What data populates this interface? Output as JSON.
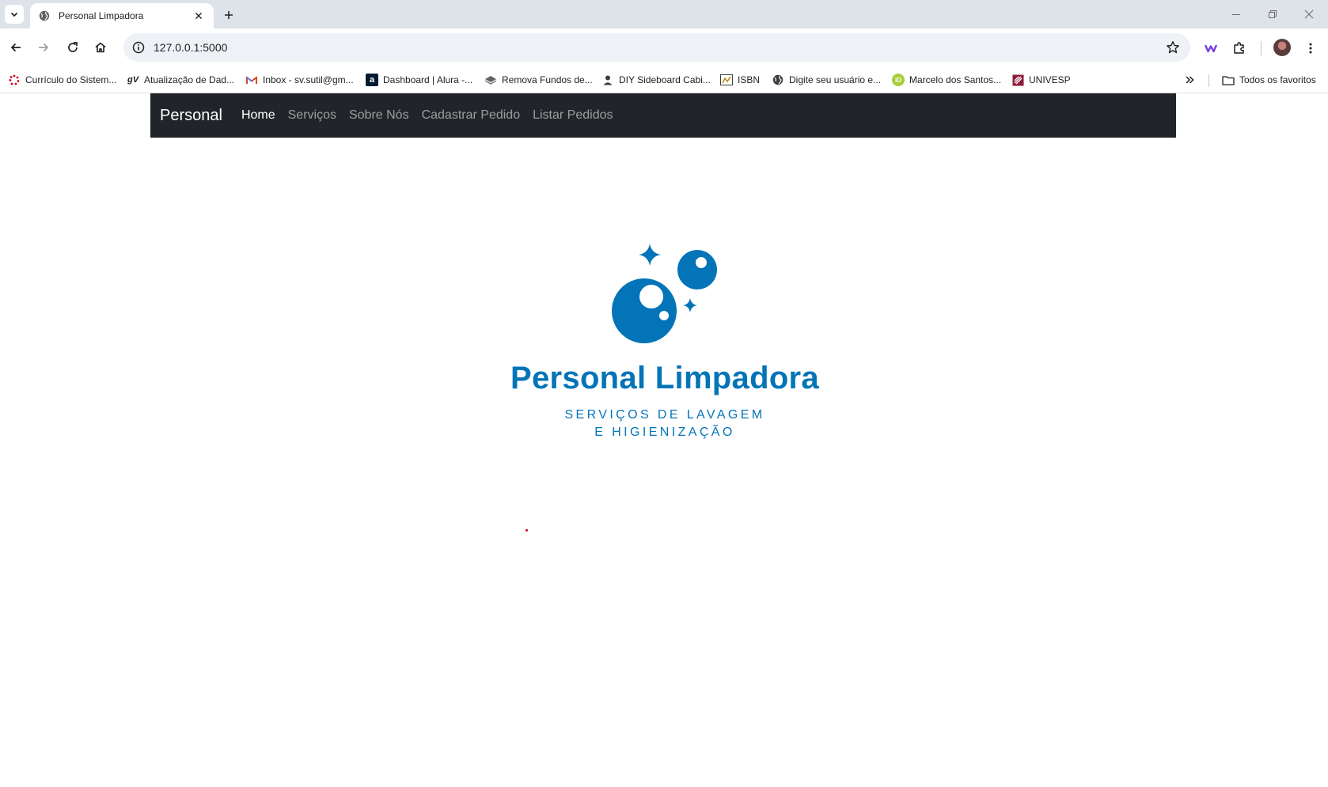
{
  "browser": {
    "tab_title": "Personal Limpadora",
    "url": "127.0.0.1:5000",
    "bookmarks": [
      {
        "label": "Currículo do Sistem...",
        "icon": "lattes-icon"
      },
      {
        "label": "Atualização de Dad...",
        "icon": "gv-icon"
      },
      {
        "label": "Inbox - sv.sutil@gm...",
        "icon": "gmail-icon"
      },
      {
        "label": "Dashboard | Alura -...",
        "icon": "alura-icon"
      },
      {
        "label": "Remova Fundos de...",
        "icon": "layers-icon"
      },
      {
        "label": "DIY Sideboard Cabi...",
        "icon": "person-icon"
      },
      {
        "label": "ISBN",
        "icon": "isbn-icon"
      },
      {
        "label": "Digite seu usuário e...",
        "icon": "globe-icon"
      },
      {
        "label": "Marcelo dos Santos...",
        "icon": "id-icon"
      },
      {
        "label": "UNIVESP",
        "icon": "univesp-icon"
      }
    ],
    "all_bookmarks_label": "Todos os favoritos"
  },
  "navbar": {
    "brand": "Personal",
    "links": [
      "Home",
      "Serviços",
      "Sobre Nós",
      "Cadastrar Pedido",
      "Listar Pedidos"
    ],
    "active": "Home"
  },
  "logo": {
    "title": "Personal Limpadora",
    "subtitle_line1": "SERVIÇOS DE LAVAGEM",
    "subtitle_line2": "E HIGIENIZAÇÃO",
    "color": "#0474b8"
  },
  "colors": {
    "navbar_bg": "#212529",
    "brand_blue": "#0474b8"
  }
}
